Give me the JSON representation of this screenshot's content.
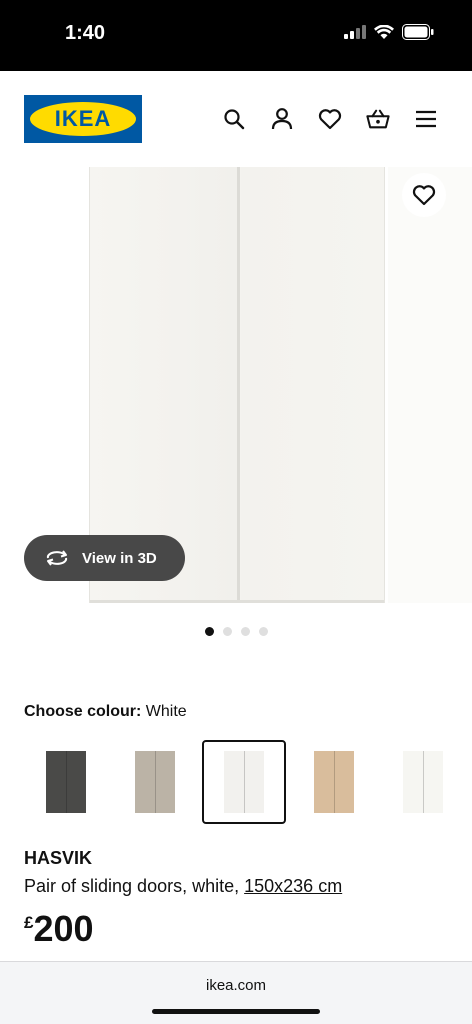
{
  "status_bar": {
    "time": "1:40"
  },
  "header": {
    "logo_text": "IKEA",
    "icons": [
      "search-icon",
      "user-icon",
      "heart-icon",
      "basket-icon",
      "menu-icon"
    ]
  },
  "gallery": {
    "view_3d_label": "View in 3D",
    "image_count": 4,
    "active_image": 1
  },
  "colour": {
    "label": "Choose colour:",
    "selected": "White",
    "swatches": [
      {
        "name": "dark grey",
        "color": "#4a4a48"
      },
      {
        "name": "beige",
        "color": "#bbb3a6"
      },
      {
        "name": "white",
        "color": "#f2f1ee",
        "selected": true
      },
      {
        "name": "oak effect",
        "color": "#d9bd9c"
      },
      {
        "name": "white high-gloss",
        "color": "#f6f6f2"
      }
    ]
  },
  "product": {
    "name": "HASVIK",
    "description": "Pair of sliding doors, white,",
    "size_link": "150x236 cm",
    "currency": "£",
    "price": "200"
  },
  "browser": {
    "url": "ikea.com"
  }
}
